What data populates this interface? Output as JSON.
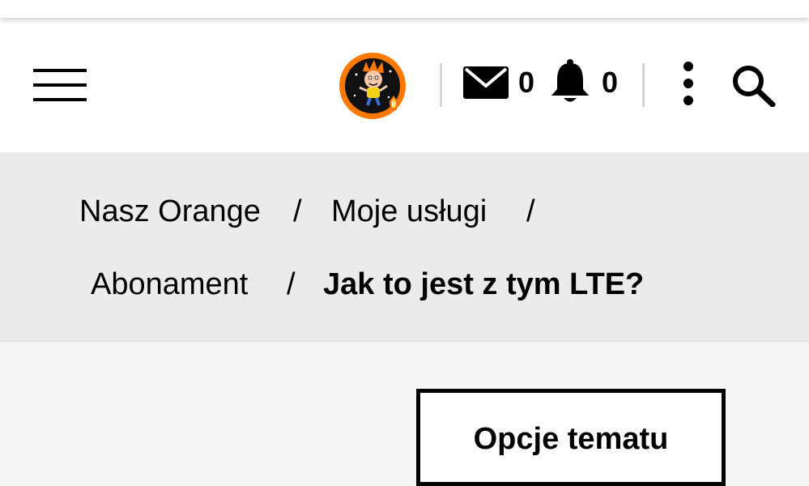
{
  "header": {
    "menu_icon": "hamburger-menu-icon",
    "avatar": {
      "icon": "user-avatar-badge",
      "ring_color": "#ff7900"
    },
    "messages": {
      "icon": "envelope-icon",
      "count": "0"
    },
    "notifications": {
      "icon": "bell-icon",
      "count": "0"
    },
    "more_icon": "more-vertical-icon",
    "search_icon": "search-icon"
  },
  "breadcrumb": {
    "items": [
      {
        "label": "Nasz Orange"
      },
      {
        "label": "Moje usługi"
      },
      {
        "label": "Abonament"
      },
      {
        "label": "Jak to jest z tym LTE?"
      }
    ],
    "separator": "/"
  },
  "topic_options": {
    "label": "Opcje tematu"
  },
  "colors": {
    "accent": "#ff7900",
    "background": "#f4f4f4",
    "breadcrumb_bg": "#ebebeb"
  }
}
